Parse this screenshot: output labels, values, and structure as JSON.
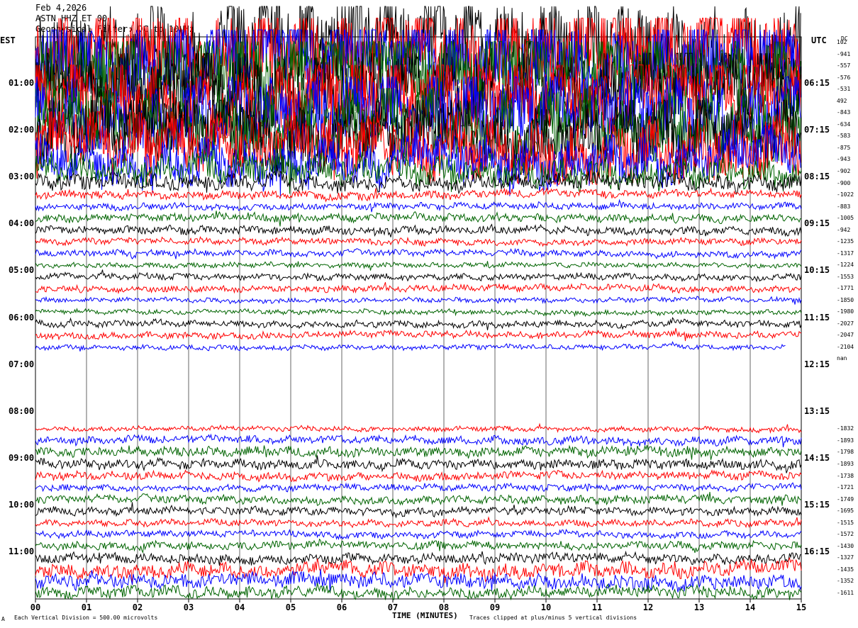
{
  "header": {
    "date": "Feb 4,2026",
    "station": "ASTN HHZ ET 00",
    "filter": "Geophysical Filter: DC to 10 Hz"
  },
  "left_axis_title": "EST",
  "right_axis_title": "UTC",
  "dc_title": "DC",
  "footer": {
    "scale_mark": "A",
    "vertical_division": "Each Vertical Division =  500.00 microvolts",
    "clip_note": "Traces clipped at plus/minus 5 vertical divisions"
  },
  "chart_data": {
    "type": "line",
    "title": "",
    "xlabel": "TIME (MINUTES)",
    "ylabel": "",
    "x_ticks": [
      "00",
      "01",
      "02",
      "03",
      "04",
      "05",
      "06",
      "07",
      "08",
      "09",
      "10",
      "11",
      "12",
      "13",
      "14",
      "15"
    ],
    "xlim": [
      0,
      15
    ],
    "row_minutes": 15,
    "rows": 48,
    "est_labels": [
      "01:00",
      "02:00",
      "03:00",
      "04:00",
      "05:00",
      "06:00",
      "07:00",
      "08:00",
      "09:00",
      "10:00",
      "11:00"
    ],
    "utc_labels": [
      "06:15",
      "07:15",
      "08:15",
      "09:15",
      "10:15",
      "11:15",
      "12:15",
      "13:15",
      "14:15",
      "15:15",
      "16:15"
    ],
    "trace_colors": [
      "#000000",
      "#ff0000",
      "#0000ff",
      "#006400"
    ],
    "clip_divisions": 5,
    "grid": true,
    "dc_offsets": [
      "102",
      "-941",
      "-557",
      "-576",
      "-531",
      "492",
      "-843",
      "-634",
      "-583",
      "-875",
      "-943",
      "-902",
      "-900",
      "-1022",
      "-883",
      "-1005",
      "-942",
      "-1235",
      "-1317",
      "-1224",
      "-1553",
      "-1771",
      "-1850",
      "-1980",
      "-2027",
      "-2047",
      "-2104",
      "nan",
      "-1832",
      "-1893",
      "-1798",
      "-1893",
      "-1738",
      "-1721",
      "-1749",
      "-1695",
      "-1515",
      "-1572",
      "-1430",
      "-1327",
      "-1435",
      "-1352",
      "-1611"
    ],
    "traces": [
      {
        "row": 0,
        "amplitude": 60,
        "dc": "102"
      },
      {
        "row": 1,
        "amplitude": 58,
        "dc": "-941"
      },
      {
        "row": 2,
        "amplitude": 56,
        "dc": "-557"
      },
      {
        "row": 3,
        "amplitude": 55,
        "dc": "-576"
      },
      {
        "row": 4,
        "amplitude": 52,
        "dc": "-531"
      },
      {
        "row": 5,
        "amplitude": 50,
        "dc": "492"
      },
      {
        "row": 6,
        "amplitude": 48,
        "dc": "-843"
      },
      {
        "row": 7,
        "amplitude": 46,
        "dc": "-634"
      },
      {
        "row": 8,
        "amplitude": 42,
        "dc": "-583"
      },
      {
        "row": 9,
        "amplitude": 38,
        "dc": "-875"
      },
      {
        "row": 10,
        "amplitude": 28,
        "dc": "-943"
      },
      {
        "row": 11,
        "amplitude": 18,
        "dc": "-902"
      },
      {
        "row": 12,
        "amplitude": 10,
        "dc": "-900"
      },
      {
        "row": 13,
        "amplitude": 5,
        "dc": "-1022"
      },
      {
        "row": 14,
        "amplitude": 4,
        "dc": "-883"
      },
      {
        "row": 15,
        "amplitude": 5,
        "dc": "-1005"
      },
      {
        "row": 16,
        "amplitude": 5,
        "dc": "-942"
      },
      {
        "row": 17,
        "amplitude": 4,
        "dc": "-1235"
      },
      {
        "row": 18,
        "amplitude": 4,
        "dc": "-1317"
      },
      {
        "row": 19,
        "amplitude": 3,
        "dc": "-1224"
      },
      {
        "row": 20,
        "amplitude": 4,
        "dc": "-1553"
      },
      {
        "row": 21,
        "amplitude": 4,
        "dc": "-1771"
      },
      {
        "row": 22,
        "amplitude": 3,
        "dc": "-1850"
      },
      {
        "row": 23,
        "amplitude": 3,
        "dc": "-1980"
      },
      {
        "row": 24,
        "amplitude": 4,
        "dc": "-2027"
      },
      {
        "row": 25,
        "amplitude": 4,
        "dc": "-2047"
      },
      {
        "row": 26,
        "amplitude": 3,
        "dc": "-2104",
        "end_minute": 14.7
      },
      {
        "row": 27,
        "amplitude": 0,
        "dc": "nan",
        "empty": true
      },
      {
        "row": 33,
        "amplitude": 3,
        "dc": "-1832"
      },
      {
        "row": 34,
        "amplitude": 5,
        "dc": "-1893"
      },
      {
        "row": 35,
        "amplitude": 6,
        "dc": "-1798"
      },
      {
        "row": 36,
        "amplitude": 6,
        "dc": "-1893"
      },
      {
        "row": 37,
        "amplitude": 5,
        "dc": "-1738"
      },
      {
        "row": 38,
        "amplitude": 4,
        "dc": "-1721"
      },
      {
        "row": 39,
        "amplitude": 5,
        "dc": "-1749"
      },
      {
        "row": 40,
        "amplitude": 5,
        "dc": "-1695"
      },
      {
        "row": 41,
        "amplitude": 4,
        "dc": "-1515"
      },
      {
        "row": 42,
        "amplitude": 4,
        "dc": "-1572"
      },
      {
        "row": 43,
        "amplitude": 5,
        "dc": "-1430"
      },
      {
        "row": 44,
        "amplitude": 6,
        "dc": "-1327"
      },
      {
        "row": 45,
        "amplitude": 9,
        "dc": "-1435"
      },
      {
        "row": 46,
        "amplitude": 9,
        "dc": "-1352"
      },
      {
        "row": 47,
        "amplitude": 7,
        "dc": "-1611"
      }
    ]
  }
}
